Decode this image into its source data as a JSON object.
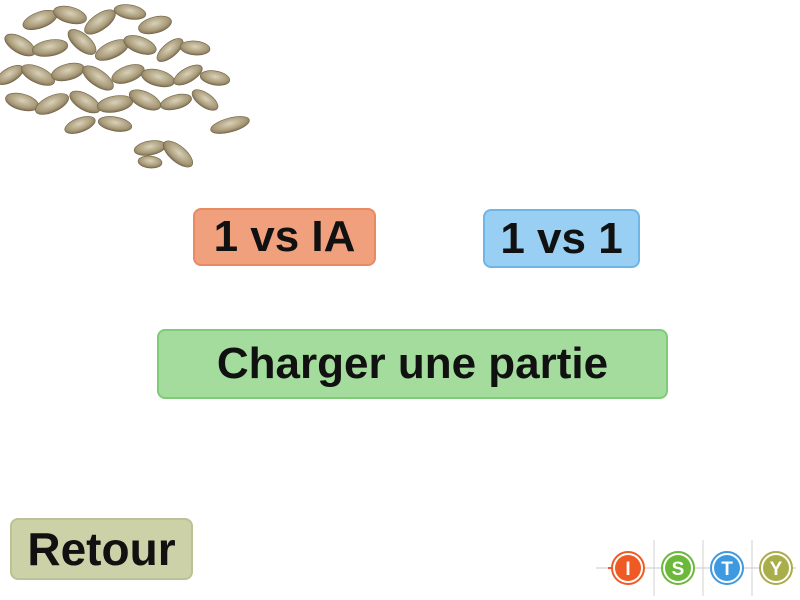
{
  "menu": {
    "vs_ai_label": "1 vs IA",
    "vs_player_label": "1 vs 1",
    "load_game_label": "Charger une partie",
    "back_label": "Retour"
  },
  "logo": {
    "letters": [
      "I",
      "S",
      "T",
      "Y"
    ],
    "colors": [
      "#ef5a24",
      "#6bb83b",
      "#3d9ae0",
      "#a9ad4a"
    ]
  },
  "decor": {
    "image": "sunflower-seeds"
  }
}
